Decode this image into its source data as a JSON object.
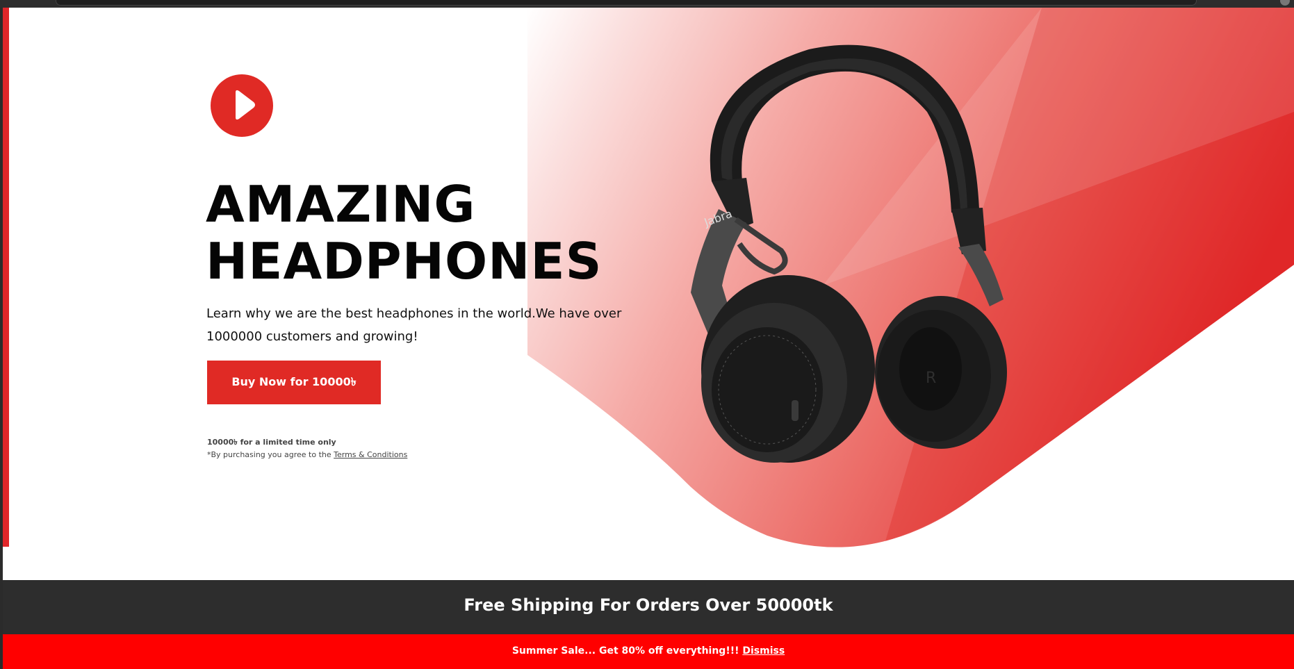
{
  "hero": {
    "title_line1": "AMAZING",
    "title_line2": "HEADPHONES",
    "description": "Learn why we are the best headphones in the world.We have over 1000000 customers and growing!",
    "buy_button_label": "Buy Now for 10000৳",
    "limited_note": "10000৳ for a limited time only",
    "terms_prefix": "*By purchasing you agree to the ",
    "terms_link": "Terms & Conditions",
    "product_brand": "Jabra"
  },
  "shipping_banner": {
    "text": "Free Shipping For Orders Over 50000tk"
  },
  "sale_banner": {
    "text": "Summer Sale... Get 80% off everything!!! ",
    "dismiss_label": "Dismiss"
  },
  "colors": {
    "accent": "#e02a25",
    "sale_red": "#ff0000",
    "dark_bar": "#2d2d2d"
  },
  "icons": {
    "play": "play-icon"
  }
}
